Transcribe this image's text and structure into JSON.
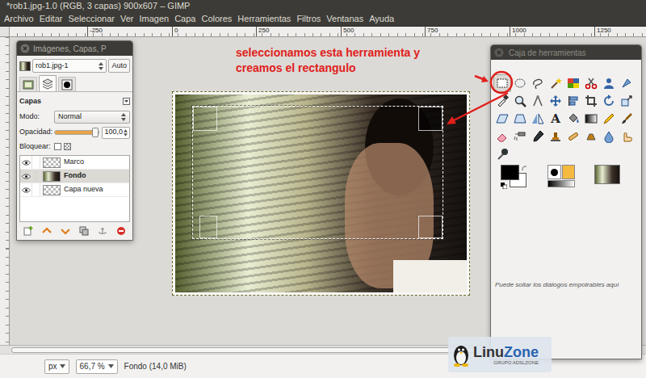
{
  "window": {
    "title": "*rob1.jpg-1.0 (RGB, 3 capas) 900x607 – GIMP"
  },
  "menu": [
    "Archivo",
    "Editar",
    "Seleccionar",
    "Ver",
    "Imagen",
    "Capa",
    "Colores",
    "Herramientas",
    "Filtros",
    "Ventanas",
    "Ayuda"
  ],
  "ruler": {
    "labels": [
      "-250",
      "0",
      "250",
      "500",
      "750",
      "1000",
      "1250"
    ]
  },
  "annotation": {
    "lines": [
      "seleccionamos esta herramienta y",
      "creamos el rectangulo"
    ]
  },
  "layers_dock": {
    "title": "Imágenes, Capas, P",
    "image": "rob1.jpg-1",
    "auto": "Auto",
    "tabs": [
      {
        "kind": "images",
        "selected": false
      },
      {
        "kind": "layers",
        "selected": true
      },
      {
        "kind": "channels",
        "selected": false
      }
    ],
    "section": "Capas",
    "mode_label": "Modo:",
    "mode": "Normal",
    "opacity_label": "Opacidad:",
    "opacity": "100,0",
    "opacity_level": 1.0,
    "lock_label": "Bloquear:",
    "lock_checked": false,
    "layers": [
      {
        "name": "Marco",
        "kind": "transparent",
        "visible": true,
        "selected": false
      },
      {
        "name": "Fondo",
        "kind": "photo",
        "visible": true,
        "selected": true
      },
      {
        "name": "Capa nueva",
        "kind": "transparent",
        "visible": true,
        "selected": false
      }
    ]
  },
  "toolbox": {
    "title": "Caja de herramientas",
    "tools": [
      {
        "kind": "rect-select",
        "selected": true
      },
      {
        "kind": "ellipse-select",
        "selected": false
      },
      {
        "kind": "free-select",
        "selected": false
      },
      {
        "kind": "fuzzy-select",
        "selected": false
      },
      {
        "kind": "color-select",
        "selected": false
      },
      {
        "kind": "scissors",
        "selected": false
      },
      {
        "kind": "foreground-select",
        "selected": false
      },
      {
        "kind": "paths",
        "selected": false
      },
      {
        "kind": "color-picker",
        "selected": false
      },
      {
        "kind": "zoom",
        "selected": false
      },
      {
        "kind": "measure",
        "selected": false
      },
      {
        "kind": "move",
        "selected": false
      },
      {
        "kind": "align",
        "selected": false
      },
      {
        "kind": "crop",
        "selected": false
      },
      {
        "kind": "rotate",
        "selected": false
      },
      {
        "kind": "scale",
        "selected": false
      },
      {
        "kind": "shear",
        "selected": false
      },
      {
        "kind": "perspective",
        "selected": false
      },
      {
        "kind": "flip",
        "selected": false
      },
      {
        "kind": "text",
        "selected": false,
        "label": "A"
      },
      {
        "kind": "bucket",
        "selected": false
      },
      {
        "kind": "gradient",
        "selected": false
      },
      {
        "kind": "pencil",
        "selected": false
      },
      {
        "kind": "paintbrush",
        "selected": false
      },
      {
        "kind": "eraser",
        "selected": false
      },
      {
        "kind": "airbrush",
        "selected": false
      },
      {
        "kind": "ink",
        "selected": false
      },
      {
        "kind": "clone",
        "selected": false
      },
      {
        "kind": "heal",
        "selected": false
      },
      {
        "kind": "perspective-clone",
        "selected": false
      },
      {
        "kind": "blur",
        "selected": false
      },
      {
        "kind": "smudge",
        "selected": false
      },
      {
        "kind": "dodge",
        "selected": false
      }
    ],
    "hint": "Puede soltar los diálogos empotrables aquí"
  },
  "status_bar": {
    "unit": "px",
    "zoom": "66,7 %",
    "info": "Fondo (14,0 MiB)"
  },
  "watermark": {
    "brand_a": "Linu",
    "brand_b": "Zone",
    "tagline": "GRUPO ADSLZONE"
  }
}
